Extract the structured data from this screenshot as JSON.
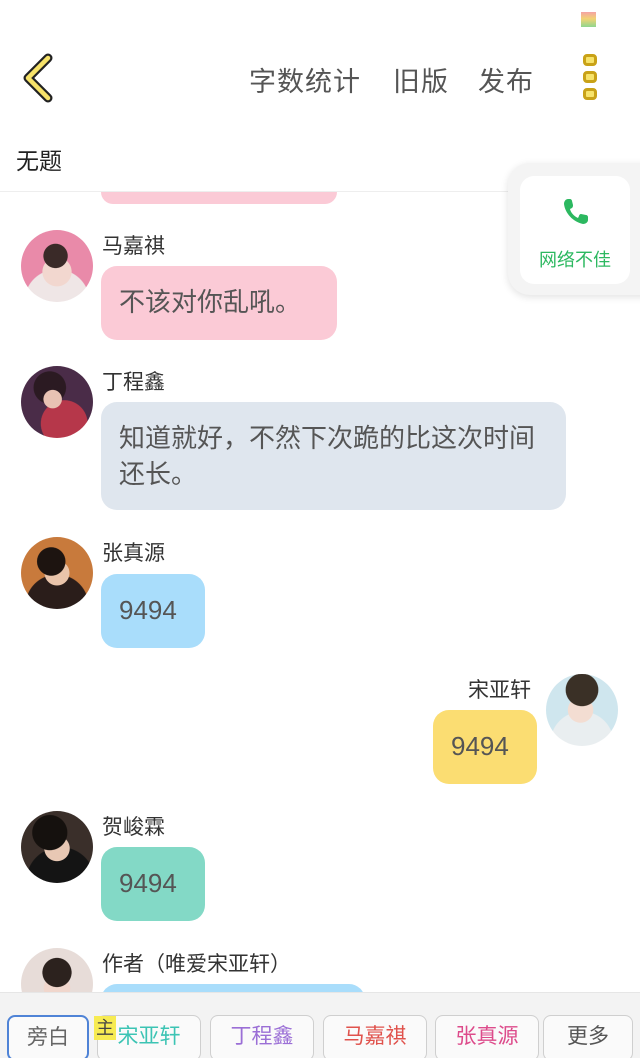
{
  "header": {
    "actions": [
      "字数统计",
      "旧版",
      "发布"
    ],
    "title": "无题"
  },
  "network_popup": {
    "text": "网络不佳"
  },
  "messages": [
    {
      "sender": "马嘉祺",
      "text": "不该对你乱吼。",
      "bubble_color": "#fbcad6",
      "side": "left"
    },
    {
      "sender": "丁程鑫",
      "text": "知道就好，不然下次跪的比这次时间还长。",
      "bubble_color": "#dfe6ee",
      "side": "left"
    },
    {
      "sender": "张真源",
      "text": "9494",
      "bubble_color": "#a9ddfb",
      "side": "left"
    },
    {
      "sender": "宋亚轩",
      "text": "9494",
      "bubble_color": "#fbdd72",
      "side": "right"
    },
    {
      "sender": "贺峻霖",
      "text": "9494",
      "bubble_color": "#83d9c6",
      "side": "left"
    },
    {
      "sender": "作者（唯爱宋亚轩）",
      "text": "",
      "bubble_color": "#a9ddfb",
      "side": "left"
    }
  ],
  "character_bar": {
    "main_badge": "主",
    "buttons": [
      {
        "label": "旁白",
        "color": "#666666"
      },
      {
        "label": "宋亚轩",
        "color": "#3cc4b4"
      },
      {
        "label": "丁程鑫",
        "color": "#9b6fd6"
      },
      {
        "label": "马嘉祺",
        "color": "#e0524c"
      },
      {
        "label": "张真源",
        "color": "#dd4b8b"
      },
      {
        "label": "更多",
        "color": "#555555"
      }
    ]
  },
  "colors": {
    "accent_yellow": "#f7e36a",
    "network_green": "#2cb860"
  }
}
